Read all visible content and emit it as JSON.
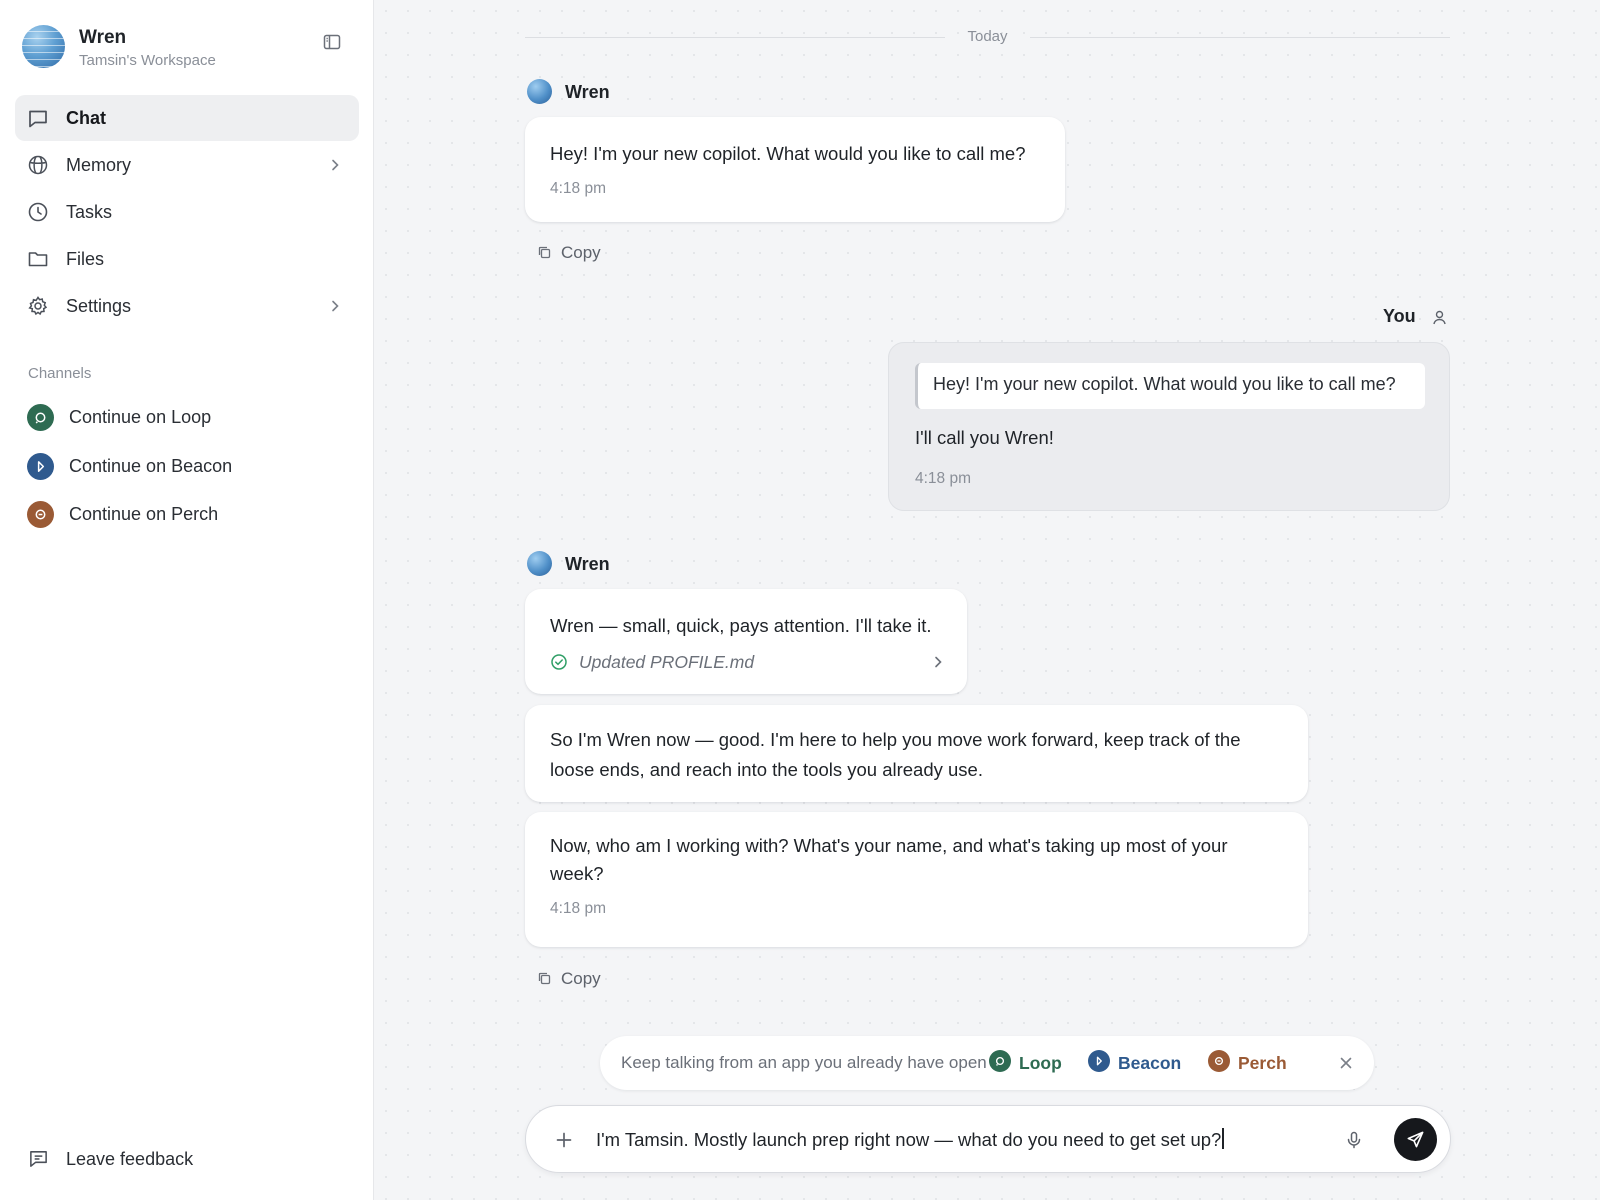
{
  "workspace": {
    "name": "Wren",
    "subtitle": "Tamsin's Workspace",
    "avatar_icon": "globe-avatar",
    "collapse_icon": "sidebar-toggle-icon"
  },
  "nav": {
    "items": [
      {
        "label": "Chat",
        "icon": "chat-bubble-icon",
        "active": true
      },
      {
        "label": "Memory",
        "icon": "memory-icon",
        "has_chevron": true
      },
      {
        "label": "Tasks",
        "icon": "clock-icon"
      },
      {
        "label": "Files",
        "icon": "folder-icon"
      },
      {
        "label": "Settings",
        "icon": "gear-icon",
        "has_chevron": true
      }
    ]
  },
  "channels": {
    "title": "Channels",
    "items": [
      {
        "label": "Continue on Loop",
        "icon": "loop-icon",
        "color": "#2e6b52"
      },
      {
        "label": "Continue on Beacon",
        "icon": "beacon-icon",
        "color": "#2f5a8e"
      },
      {
        "label": "Continue on Perch",
        "icon": "perch-icon",
        "color": "#9a5a35"
      }
    ]
  },
  "feedback": {
    "label": "Leave feedback",
    "icon": "feedback-icon"
  },
  "chat": {
    "day_label": "Today",
    "assistant_name": "Wren",
    "user_name": "You",
    "copy_label": "Copy",
    "messages": {
      "m1": {
        "text": "Hey! I'm your new copilot. What would you like to call me?",
        "time": "4:18 pm"
      },
      "user": {
        "quote": "Hey! I'm your new copilot. What would you like to call me?",
        "text": "I'll call you Wren!",
        "time": "4:18 pm"
      },
      "m2": {
        "text": "Wren — small, quick, pays attention. I'll take it.",
        "update": "Updated PROFILE.md"
      },
      "m3": {
        "text": "So I'm Wren now — good. I'm here to help you move work forward, keep track of the loose ends, and reach into the tools you already use."
      },
      "m4": {
        "text": "Now, who am I working with? What's your name, and what's taking up most of your week?",
        "time": "4:18 pm"
      }
    }
  },
  "suggestion": {
    "text": "Keep talking from an app you already have open",
    "chips": [
      {
        "label": "Loop",
        "color": "#2e6b52"
      },
      {
        "label": "Beacon",
        "color": "#2f5a8e"
      },
      {
        "label": "Perch",
        "color": "#9a5a35"
      }
    ]
  },
  "composer": {
    "value": "I'm Tamsin. Mostly launch prep right now — what do you need to get set up?",
    "plus_icon": "plus-icon",
    "mic_icon": "microphone-icon",
    "send_icon": "send-icon"
  },
  "colors": {
    "accent": "#16181c",
    "success": "#2f9e66",
    "background": "#f4f5f7"
  }
}
